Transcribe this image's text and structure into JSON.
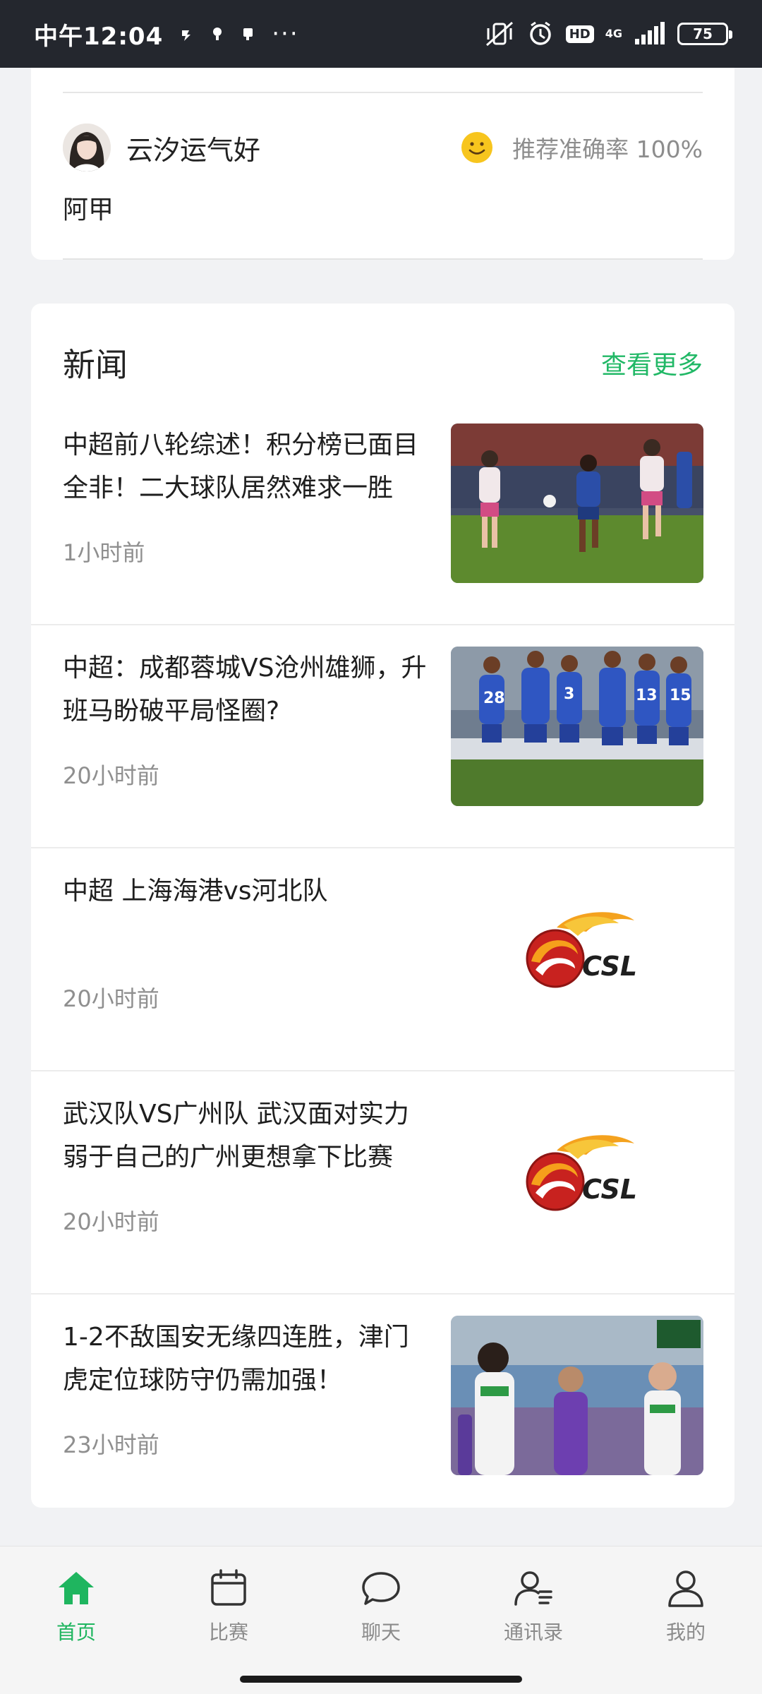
{
  "status_bar": {
    "time": "中午12:04",
    "dots": "···",
    "hd": "HD",
    "network": "4G",
    "battery": "75"
  },
  "featured_pick": {
    "username": "云汐运气好",
    "accuracy": "推荐准确率 100%",
    "pick": "阿甲"
  },
  "news": {
    "title": "新闻",
    "more": "查看更多",
    "items": [
      {
        "headline": "中超前八轮综述！积分榜已面目全非！二大球队居然难求一胜",
        "time": "1小时前",
        "thumb": "soccer-photo"
      },
      {
        "headline": "中超：成都蓉城VS沧州雄狮，升班马盼破平局怪圈?",
        "time": "20小时前",
        "thumb": "soccer-photo"
      },
      {
        "headline": "中超 上海海港vs河北队",
        "time": "20小时前",
        "thumb": "csl-logo",
        "logo_text": "CSL"
      },
      {
        "headline": "武汉队VS广州队 武汉面对实力弱于自己的广州更想拿下比赛",
        "time": "20小时前",
        "thumb": "csl-logo",
        "logo_text": "CSL"
      },
      {
        "headline": "1-2不敌国安无缘四连胜，津门虎定位球防守仍需加强！",
        "time": "23小时前",
        "thumb": "soccer-photo"
      }
    ]
  },
  "bottom_nav": [
    {
      "label": "首页",
      "icon": "home-icon",
      "active": true
    },
    {
      "label": "比赛",
      "icon": "calendar-icon",
      "active": false
    },
    {
      "label": "聊天",
      "icon": "chat-icon",
      "active": false
    },
    {
      "label": "通讯录",
      "icon": "contacts-icon",
      "active": false
    },
    {
      "label": "我的",
      "icon": "profile-icon",
      "active": false
    }
  ],
  "colors": {
    "accent": "#1fb55f",
    "link": "#21b866",
    "status_bar": "#24272e"
  }
}
